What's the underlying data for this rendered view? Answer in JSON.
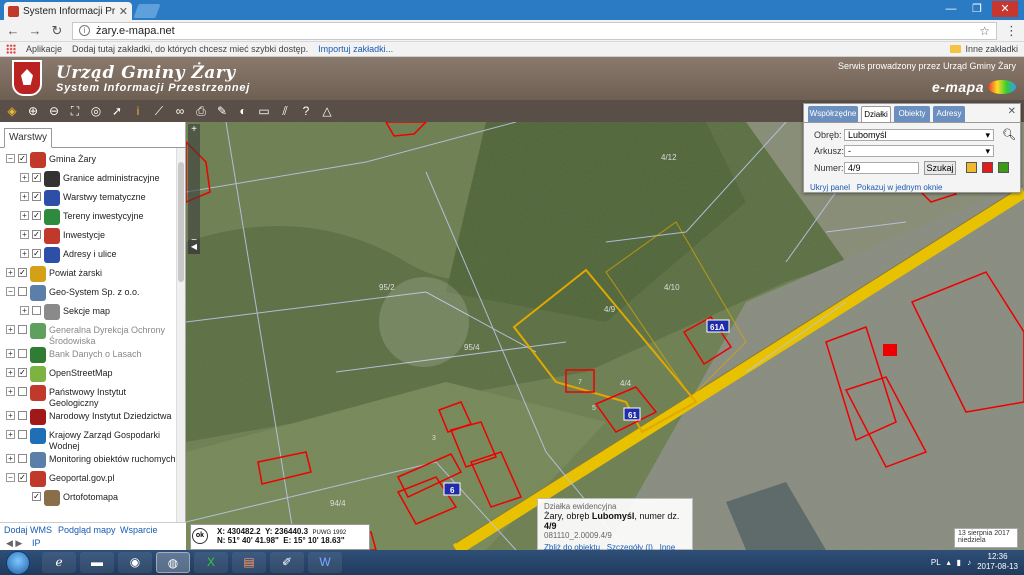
{
  "browser": {
    "tab_title": "System Informacji Przes",
    "url": "żary.e-mapa.net",
    "bookmarks_apps": "Aplikacje",
    "bookmarks_hint": "Dodaj tutaj zakładki, do których chcesz mieć szybki dostęp.",
    "bookmarks_import": "Importuj zakładki...",
    "other_bookmarks": "Inne zakładki"
  },
  "header": {
    "title": "Urząd Gminy Żary",
    "subtitle": "System Informacji Przestrzennej",
    "service_note": "Serwis prowadzony przez Urząd Gminy Żary",
    "brand": "e-mapa"
  },
  "sidebar": {
    "tab": "Warstwy",
    "layers": [
      {
        "label": "Gmina Żary",
        "indent": 0,
        "pm": "−",
        "checked": true,
        "icon_color": "#c0392b",
        "icon": "coat-of-arms-icon",
        "grey": false
      },
      {
        "label": "Granice administracyjne",
        "indent": 1,
        "pm": "+",
        "checked": true,
        "icon_color": "#333333",
        "icon": "boundary-icon",
        "grey": false
      },
      {
        "label": "Warstwy tematyczne",
        "indent": 1,
        "pm": "+",
        "checked": true,
        "icon_color": "#2e4fa8",
        "icon": "layers-icon",
        "grey": false
      },
      {
        "label": "Tereny inwestycyjne",
        "indent": 1,
        "pm": "+",
        "checked": true,
        "icon_color": "#2e8b3e",
        "icon": "dollar-icon",
        "grey": false
      },
      {
        "label": "Inwestycje",
        "indent": 1,
        "pm": "+",
        "checked": true,
        "icon_color": "#c0392b",
        "icon": "excavator-icon",
        "grey": false
      },
      {
        "label": "Adresy i ulice",
        "indent": 1,
        "pm": "+",
        "checked": true,
        "icon_color": "#2e4fa8",
        "icon": "address-icon",
        "grey": false
      },
      {
        "label": "Powiat żarski",
        "indent": 0,
        "pm": "+",
        "checked": true,
        "icon_color": "#d4a017",
        "icon": "county-icon",
        "grey": false
      },
      {
        "label": "Geo-System Sp. z o.o.",
        "indent": 0,
        "pm": "−",
        "checked": false,
        "icon_color": "#5b7fa8",
        "icon": "geosystem-icon",
        "grey": false
      },
      {
        "label": "Sekcje map",
        "indent": 1,
        "pm": "+",
        "checked": false,
        "icon_color": "#8a8a8a",
        "icon": "grid-icon",
        "grey": false
      },
      {
        "label": "Generalna Dyrekcja Ochrony Środowiska",
        "indent": 0,
        "pm": "+",
        "checked": false,
        "icon_color": "#5fa05f",
        "icon": "leaf-icon",
        "grey": true
      },
      {
        "label": "Bank Danych o Lasach",
        "indent": 0,
        "pm": "+",
        "checked": false,
        "icon_color": "#2e7d32",
        "icon": "tree-icon",
        "grey": true
      },
      {
        "label": "OpenStreetMap",
        "indent": 0,
        "pm": "+",
        "checked": true,
        "icon_color": "#7cb342",
        "icon": "osm-icon",
        "grey": false
      },
      {
        "label": "Państwowy Instytut Geologiczny",
        "indent": 0,
        "pm": "+",
        "checked": false,
        "icon_color": "#c0392b",
        "icon": "geology-icon",
        "grey": false
      },
      {
        "label": "Narodowy Instytut Dziedzictwa",
        "indent": 0,
        "pm": "+",
        "checked": false,
        "icon_color": "#a01818",
        "icon": "heritage-icon",
        "grey": false
      },
      {
        "label": "Krajowy Zarząd Gospodarki Wodnej",
        "indent": 0,
        "pm": "+",
        "checked": false,
        "icon_color": "#1e6fb5",
        "icon": "water-icon",
        "grey": false
      },
      {
        "label": "Monitoring obiektów ruchomych",
        "indent": 0,
        "pm": "+",
        "checked": false,
        "icon_color": "#5b7fa8",
        "icon": "satellite-icon",
        "grey": false
      },
      {
        "label": "Geoportal.gov.pl",
        "indent": 0,
        "pm": "−",
        "checked": true,
        "icon_color": "#c0392b",
        "icon": "geoportal-icon",
        "grey": false
      },
      {
        "label": "Ortofotomapa",
        "indent": 1,
        "pm": "",
        "checked": true,
        "icon_color": "#8a6d4a",
        "icon": "orthophoto-icon",
        "grey": false
      }
    ],
    "footer": {
      "add_wms": "Dodaj WMS",
      "preview": "Podgląd mapy",
      "support": "Wsparcie",
      "ip": "IP"
    }
  },
  "coords": {
    "x": "X: 430482.2",
    "y": "Y: 236440.3",
    "system": "PUWG 1992",
    "n": "N: 51° 40' 41.98\"",
    "e": "E: 15° 10' 18.63\"",
    "ok": "ok"
  },
  "search_panel": {
    "tabs": [
      "Współrzędne",
      "Działki",
      "Obiekty",
      "Adresy"
    ],
    "active_tab": 1,
    "obreb_label": "Obręb:",
    "obreb_value": "Lubomyśl",
    "arkusz_label": "Arkusz:",
    "arkusz_value": "-",
    "numer_label": "Numer:",
    "numer_value": "4/9",
    "search_button": "Szukaj",
    "swatches": [
      "#f2b92f",
      "#e31b1b",
      "#3a9b16"
    ],
    "hide_link": "Ukryj panel",
    "one_window_link": "Pokazuj w jednym oknie"
  },
  "plot_info": {
    "heading": "Działka ewidencyjna",
    "line1_prefix": "Żary, obręb ",
    "line1_obreb": "Lubomyśl",
    "line1_mid": ", numer dz.",
    "line1_num": "4/9",
    "line2": "081110_2.0009.4/9",
    "zoom": "Zbliż do obiektu",
    "details": "Szczegóły (I)",
    "other": "Inne"
  },
  "map_labels": [
    {
      "t": "4/12",
      "c": "#ddd"
    },
    {
      "t": "95/2",
      "c": "#ddd"
    },
    {
      "t": "95/4",
      "c": "#ddd"
    },
    {
      "t": "4/10",
      "c": "#ddd"
    },
    {
      "t": "4/9",
      "c": "#ddd"
    },
    {
      "t": "4/4",
      "c": "#ddd"
    },
    {
      "t": "94/4",
      "c": "#ddd"
    },
    {
      "t": "61A",
      "c": "#fff"
    },
    {
      "t": "61",
      "c": "#fff"
    },
    {
      "t": "6",
      "c": "#fff"
    },
    {
      "t": "7",
      "c": "#ddd"
    },
    {
      "t": "5",
      "c": "#ddd"
    },
    {
      "t": "3",
      "c": "#ddd"
    }
  ],
  "date": {
    "line1": "13 sierpnia 2017",
    "line2": "niedziela"
  },
  "taskbar": {
    "lang": "PL",
    "time": "12:36",
    "date": "2017-08-13"
  }
}
